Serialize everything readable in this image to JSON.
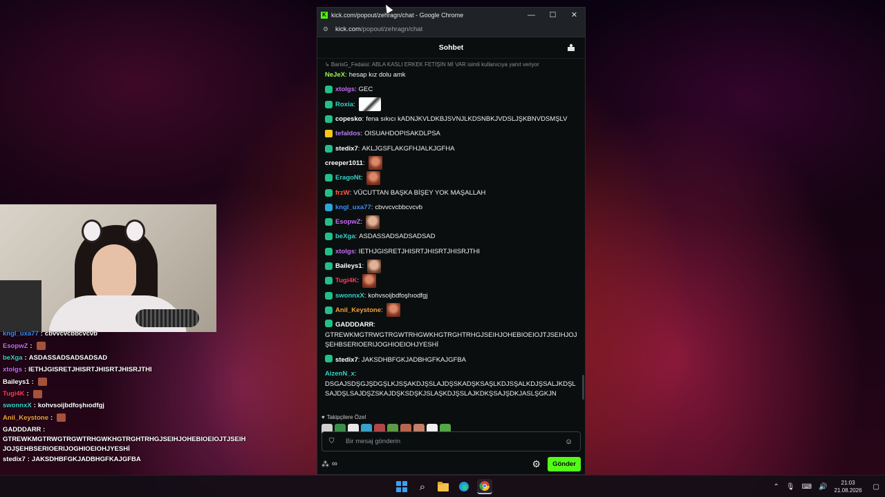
{
  "window": {
    "title": "kick.com/popout/zehragn/chat - Google Chrome",
    "url_host": "kick.com",
    "url_path": "/popout/zehragn/chat",
    "minimize": "—",
    "maximize": "☐",
    "close": "✕"
  },
  "chat": {
    "header_title": "Sohbet",
    "reply_context": "↳ BarisG_Fedaisi: ABLA KASLI ERKEK FETİŞİN Mİ VAR isimli kullanıcıya yanıt veriyor",
    "messages": [
      {
        "user": "NeJeX",
        "color": "#9cf25a",
        "badge": "none",
        "text": "hesap kız dolu amk",
        "emote": ""
      },
      {
        "user": "xtolgs",
        "color": "#c46cf2",
        "badge": "green",
        "text": "GEC",
        "emote": ""
      },
      {
        "user": "Roxia",
        "color": "#35d3c4",
        "badge": "green",
        "text": "",
        "emote": "wide"
      },
      {
        "user": "copesko",
        "color": "#ffffff",
        "badge": "green",
        "text": "fena sıkıcı kADNJKVLDKBJSVNJLKDSNBKJVDSLJŞKBNVDSMŞLV",
        "emote": ""
      },
      {
        "user": "tefaldos",
        "color": "#b27cf0",
        "badge": "k",
        "text": "OISUAHDOPISAKDLPSA",
        "emote": ""
      },
      {
        "user": "stedix7",
        "color": "#ffffff",
        "badge": "green",
        "text": "AKLJGSFLAKGFHJALKJGFHA",
        "emote": ""
      },
      {
        "user": "creeper1011",
        "color": "#ffffff",
        "badge": "none",
        "text": "",
        "emote": "face"
      },
      {
        "user": "EragoNt",
        "color": "#35d3c4",
        "badge": "green",
        "text": "",
        "emote": "face"
      },
      {
        "user": "frzW",
        "color": "#ff5a4a",
        "badge": "green",
        "text": "VÜCUTTAN BAŞKA BİŞEY YOK MAŞALLAH",
        "emote": ""
      },
      {
        "user": "kngl_uxa77",
        "color": "#3b8ef5",
        "badge": "blue",
        "text": "cbvvcvcbbcvcvb",
        "emote": ""
      },
      {
        "user": "EsopwZ",
        "color": "#c46cf2",
        "badge": "green",
        "text": "",
        "emote": "face2"
      },
      {
        "user": "beXga",
        "color": "#35d3c4",
        "badge": "green",
        "text": "ASDASSADSADSADSAD",
        "emote": ""
      },
      {
        "user": "xtolgs",
        "color": "#c46cf2",
        "badge": "green",
        "text": "IETHJGISRETJHISRTJHISRTJHISRJTHI",
        "emote": ""
      },
      {
        "user": "Baileys1",
        "color": "#ffffff",
        "badge": "green",
        "text": "",
        "emote": "face2"
      },
      {
        "user": "Tugi4K",
        "color": "#ff3b5c",
        "badge": "green",
        "text": "",
        "emote": "face"
      },
      {
        "user": "swonnxX",
        "color": "#35d3c4",
        "badge": "green",
        "text": "kohvsoijbdfoşhıodfgj",
        "emote": ""
      },
      {
        "user": "Anil_Keystone",
        "color": "#f2a23a",
        "badge": "green",
        "text": "",
        "emote": "face"
      }
    ],
    "multi_messages": [
      {
        "user": "GADDDARR",
        "color": "#ffffff",
        "badge": "green",
        "text": "GTREWKMGTRWGTRGWTRHGWKHGTRGHTRHGJSEIHJOHEBIOEIOJTJSEIHJOJŞEHBSERIOERIJOGHIOEIOHJYESHİ"
      },
      {
        "user": "stedix7",
        "color": "#ffffff",
        "badge": "green",
        "text": "JAKSDHBFGKJADBHGFKAJGFBA"
      },
      {
        "user": "AizenN_x",
        "color": "#35d3c4",
        "badge": "none",
        "text": "DSGAJSDŞGJŞDGŞLKJSŞAKDJŞSLAJDŞSKADŞKSAŞLKDJSŞALKDJŞSALJKDŞLSAJDŞLSAJDŞZSKAJDŞKSDŞKJSLAŞKDJŞSLAJKDKŞSAJŞDKJASLŞGKJN"
      }
    ],
    "emote_row_label": "Takipçilere Özel",
    "input_placeholder": "Bir mesaj gönderin",
    "send_label": "Gönder"
  },
  "overlay": {
    "lines": [
      {
        "user": "kngl_uxa77",
        "color": "#3b8ef5",
        "text": "cbvvcvcbbcvcvb",
        "emote": false
      },
      {
        "user": "EsopwZ",
        "color": "#c46cf2",
        "text": "",
        "emote": true
      },
      {
        "user": "beXga",
        "color": "#35d3c4",
        "text": "ASDASSADSADSADSAD",
        "emote": false
      },
      {
        "user": "xtolgs",
        "color": "#c46cf2",
        "text": "IETHJGISRETJHISRTJHISRTJHISRJTHI",
        "emote": false
      },
      {
        "user": "Baileys1",
        "color": "#ffffff",
        "text": "",
        "emote": true
      },
      {
        "user": "Tugi4K",
        "color": "#ff3b5c",
        "text": "",
        "emote": true
      },
      {
        "user": "swonnxX",
        "color": "#35d3c4",
        "text": "kohvsoijbdfoşhıodfgj",
        "emote": false
      },
      {
        "user": "Anil_Keystone",
        "color": "#f2a23a",
        "text": "",
        "emote": true
      }
    ],
    "gadddarr_user": "GADDDARR",
    "gadddarr_text": "GTREWKMGTRWGTRGWTRHGWKHGTRGHTRHGJSEIHJOHEBIOEIOJTJSEIHJOJŞEHBSERIOERIJOGHIOEIOHJYESHİ",
    "stedix_user": "stedix7",
    "stedix_text": "JAKSDHBFGKJADBHGFKAJGFBA"
  },
  "taskbar": {
    "time": "21:03",
    "date": "21.08.2026"
  }
}
